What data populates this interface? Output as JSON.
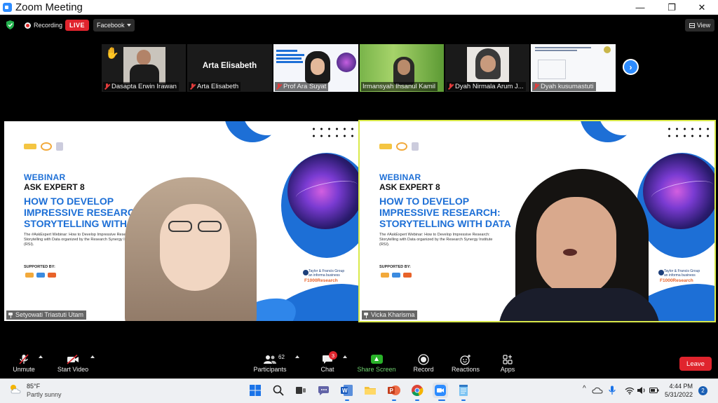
{
  "window": {
    "title": "Zoom Meeting",
    "minimize_glyph": "—",
    "maximize_glyph": "❐",
    "close_glyph": "✕"
  },
  "topbar": {
    "recording_label": "Recording",
    "live_label": "LIVE",
    "stream_target": "Facebook",
    "view_label": "View"
  },
  "thumbnails": [
    {
      "name": "Dasapta Erwin Irawan",
      "muted": true,
      "hand_raised": true
    },
    {
      "name": "Arta Elisabeth",
      "display_name": "Arta Elisabeth",
      "muted": true
    },
    {
      "name": "Prof Ara Suyat",
      "muted": true
    },
    {
      "name": "Irmansyah Ihsanul Kamil",
      "muted": false
    },
    {
      "name": "Dyah Nirmala Arum J...",
      "muted": true
    },
    {
      "name": "Dyah kusumastuti",
      "muted": true
    }
  ],
  "next_page_glyph": "›",
  "slide": {
    "webinar": "WEBINAR",
    "series": "ASK EXPERT 8",
    "headline": "HOW TO DEVELOP IMPRESSIVE RESEARCH: STORYTELLING WITH DATA",
    "description": "The #AskExpert Webinar: How to Develop Impressive Research: Storytelling with Data organized by the Research Synergy Institute (RSI).",
    "supported_by": "SUPPORTED BY:",
    "partner1": "Taylor & Francis Group",
    "partner1_sub": "an informa business",
    "partner2": "F1000Research"
  },
  "tiles": [
    {
      "name": "Setyowati Triastuti Utam"
    },
    {
      "name": "Vicka Kharisma",
      "active": true
    }
  ],
  "toolbar": {
    "unmute": "Unmute",
    "start_video": "Start Video",
    "participants": "Participants",
    "participants_count": "62",
    "chat": "Chat",
    "chat_badge": "3",
    "share_screen": "Share Screen",
    "record": "Record",
    "reactions": "Reactions",
    "apps": "Apps",
    "leave": "Leave"
  },
  "taskbar": {
    "temperature": "85°F",
    "weather": "Partly sunny",
    "time": "4:44 PM",
    "date": "5/31/2022",
    "notification_count": "2",
    "tray_chevron": "^"
  },
  "colors": {
    "live_red": "#e0242d",
    "zoom_blue": "#2d8cff",
    "share_green": "#29b229",
    "active_speaker_border": "#d9e94a",
    "slide_blue": "#1d6fd6"
  }
}
